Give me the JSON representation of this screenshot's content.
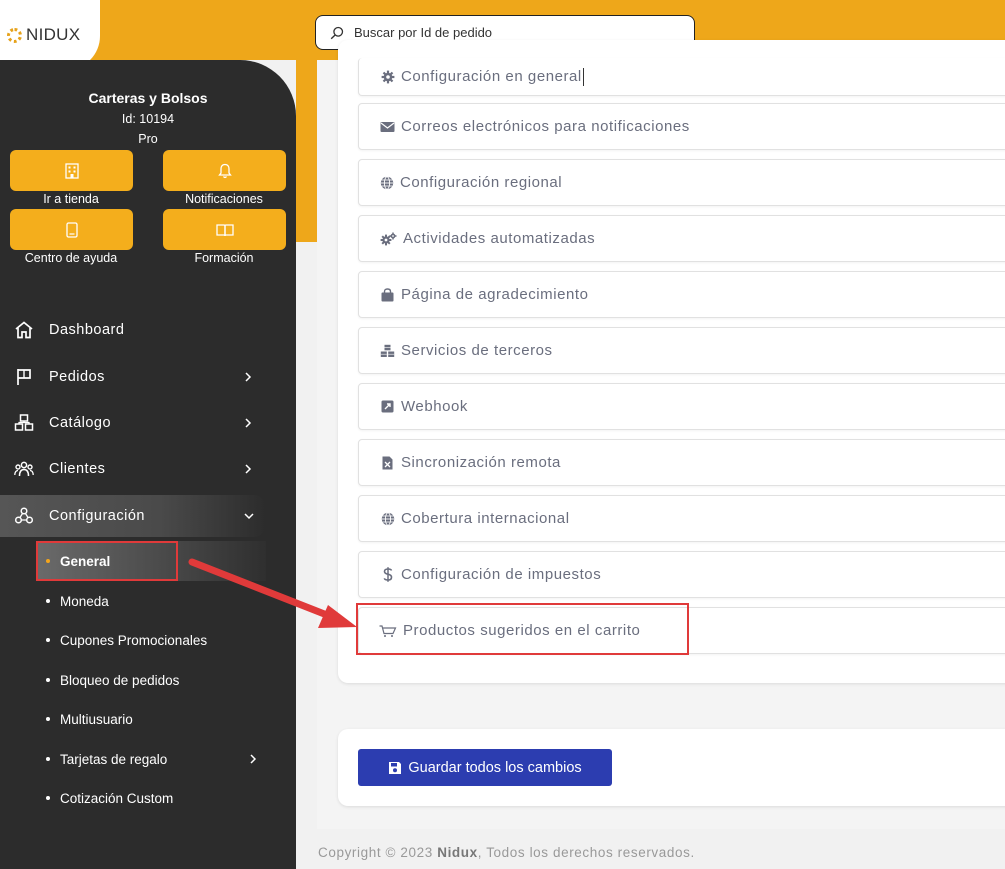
{
  "brand": {
    "name": "NIDUX",
    "accent": "#eea71a"
  },
  "search": {
    "placeholder": "Buscar por Id de pedido"
  },
  "store": {
    "name": "Carteras y Bolsos",
    "id": "Id: 10194",
    "plan": "Pro"
  },
  "quick_actions": [
    {
      "label": "Ir a tienda",
      "icon": "store-icon"
    },
    {
      "label": "Notificaciones",
      "icon": "bell-icon"
    },
    {
      "label": "Centro de ayuda",
      "icon": "tablet-icon"
    },
    {
      "label": "Formación",
      "icon": "book-icon"
    }
  ],
  "nav": [
    {
      "label": "Dashboard",
      "icon": "home-icon"
    },
    {
      "label": "Pedidos",
      "icon": "flag-icon"
    },
    {
      "label": "Catálogo",
      "icon": "boxes-icon"
    },
    {
      "label": "Clientes",
      "icon": "users-icon"
    },
    {
      "label": "Configuración",
      "icon": "settings-cluster-icon"
    }
  ],
  "config_submenu": [
    {
      "label": "General"
    },
    {
      "label": "Moneda"
    },
    {
      "label": "Cupones Promocionales"
    },
    {
      "label": "Bloqueo de pedidos"
    },
    {
      "label": "Multiusuario"
    },
    {
      "label": "Tarjetas de regalo"
    },
    {
      "label": "Cotización Custom"
    }
  ],
  "settings_list": [
    {
      "label": "Configuración en general",
      "icon": "gear-icon"
    },
    {
      "label": "Correos electrónicos para notificaciones",
      "icon": "envelope-icon"
    },
    {
      "label": "Configuración regional",
      "icon": "globe-icon"
    },
    {
      "label": "Actividades automatizadas",
      "icon": "gears-icon"
    },
    {
      "label": "Página de agradecimiento",
      "icon": "shopping-bag-icon"
    },
    {
      "label": "Servicios de terceros",
      "icon": "cubes-icon"
    },
    {
      "label": "Webhook",
      "icon": "external-link-icon"
    },
    {
      "label": "Sincronización remota",
      "icon": "excel-file-icon"
    },
    {
      "label": "Cobertura internacional",
      "icon": "globe-icon"
    },
    {
      "label": "Configuración de impuestos",
      "icon": "dollar-icon"
    },
    {
      "label": "Productos sugeridos en el carrito",
      "icon": "cart-icon"
    }
  ],
  "save": {
    "label": "Guardar todos los cambios"
  },
  "footer": {
    "prefix": "Copyright © 2023 ",
    "brand": "Nidux",
    "suffix": ", Todos los derechos reservados."
  },
  "colors": {
    "sidebar": "#2c2c2c",
    "button_yellow": "#f4ae1c",
    "save_blue": "#2c3db0",
    "highlight_red": "#e03a3a"
  }
}
